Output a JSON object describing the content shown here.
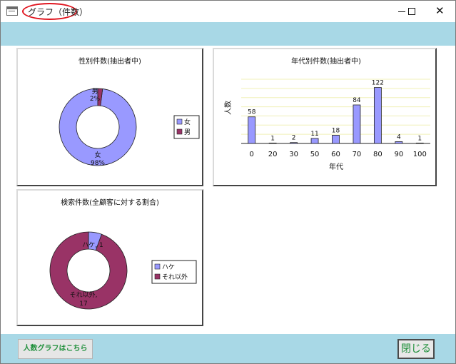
{
  "window": {
    "title": "グラフ（件数）"
  },
  "buttons": {
    "people_graph": "人数グラフはこちら",
    "close": "閉じる"
  },
  "colors": {
    "series_a": "#9999ff",
    "series_b": "#993366",
    "band": "#a8d8e6",
    "highlight_oval": "#e0141e",
    "button_text": "#1e8f3a"
  },
  "chart_data": [
    {
      "type": "pie",
      "title": "性別件数(抽出者中)",
      "categories": [
        "女",
        "男"
      ],
      "percent_labels": [
        "98%",
        "2%"
      ],
      "values": [
        98,
        2
      ],
      "legend": "right",
      "donut": true
    },
    {
      "type": "bar",
      "title": "年代別件数(抽出者中)",
      "xlabel": "年代",
      "ylabel": "人数",
      "categories": [
        "0",
        "20",
        "30",
        "50",
        "60",
        "70",
        "80",
        "90",
        "100"
      ],
      "values": [
        58,
        1,
        2,
        11,
        18,
        84,
        122,
        4,
        1
      ],
      "ylim": [
        0,
        140
      ],
      "grid": true
    },
    {
      "type": "pie",
      "title": "検索件数(全顧客に対する割合)",
      "categories": [
        "ハケ",
        "それ以外"
      ],
      "data_labels": [
        "ハケ, 1",
        "それ以外, 17"
      ],
      "values": [
        1,
        17
      ],
      "legend": "right",
      "donut": true
    }
  ]
}
